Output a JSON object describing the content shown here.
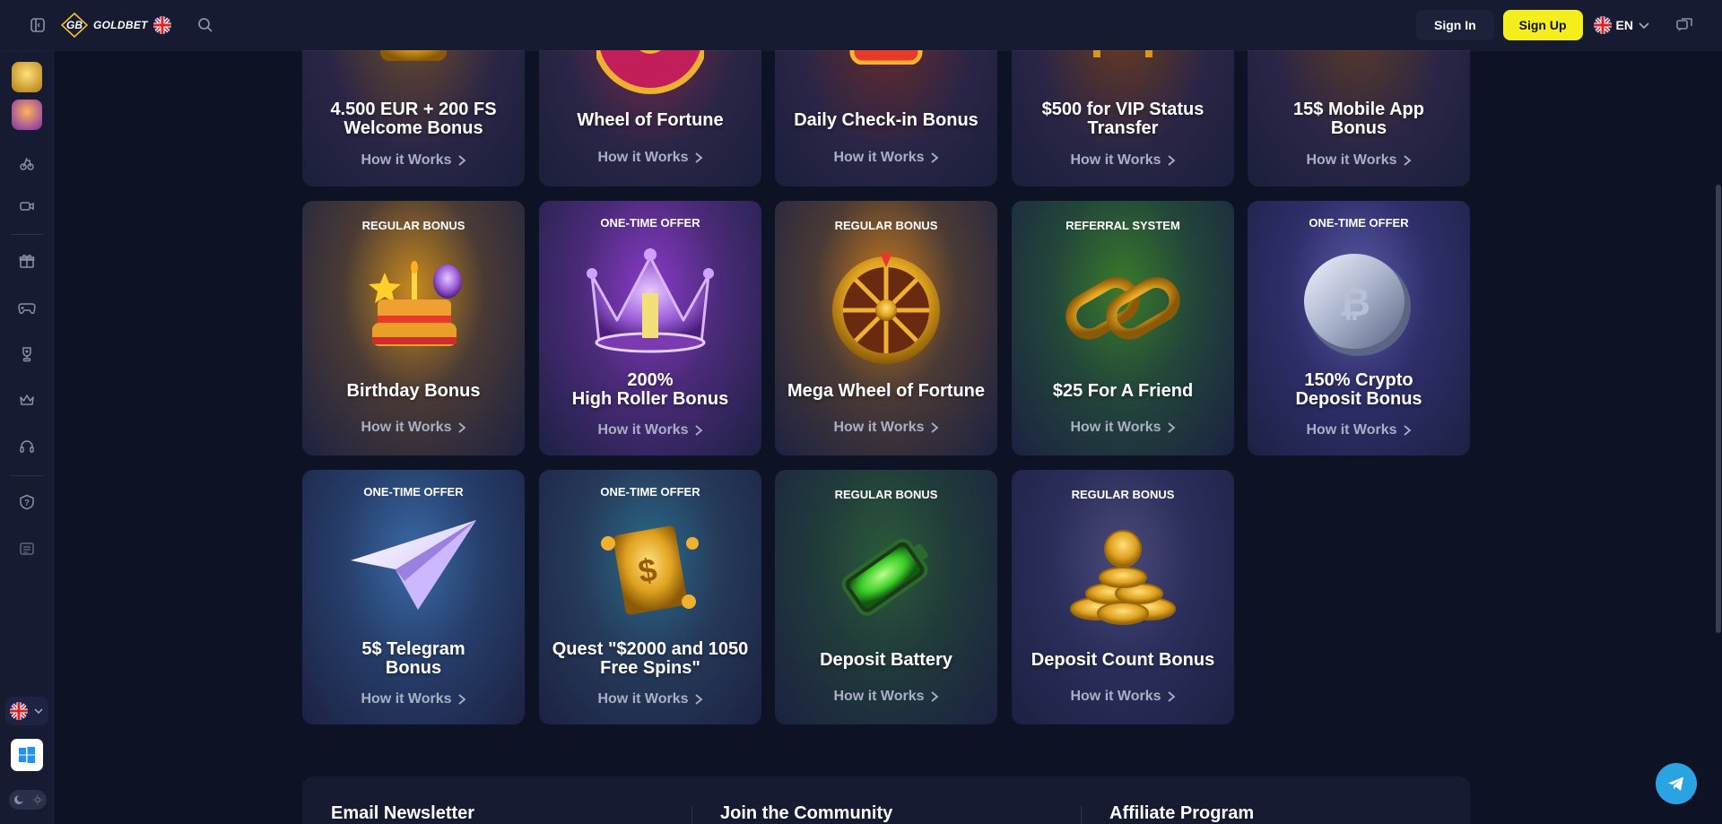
{
  "header": {
    "logo_text": "GOLDBET",
    "sign_in": "Sign In",
    "sign_up": "Sign Up",
    "language": "EN"
  },
  "icons": {
    "sidebar_toggle": "sidebar-toggle-icon",
    "search": "search-icon",
    "chat": "chat-icon"
  },
  "colors": {
    "background": "#0d1224",
    "panel": "#161b31",
    "accent_yellow": "#f4ee1d",
    "telegram": "#2aa3e3"
  },
  "sidebar": {
    "items": [
      "sports-icon",
      "live-casino-icon",
      "gift-icon",
      "gamepad-icon",
      "trophy-icon",
      "crown-icon",
      "headset-icon",
      "help-icon",
      "list-icon"
    ]
  },
  "cards_row1": [
    {
      "title": "4.500 EUR + 200 FS\nWelcome Bonus",
      "how": "How it Works"
    },
    {
      "title": "Wheel of Fortune",
      "how": "How it Works"
    },
    {
      "title": "Daily Check-in Bonus",
      "how": "How it Works"
    },
    {
      "title": "$500 for VIP Status\nTransfer",
      "how": "How it Works"
    },
    {
      "title": "15$ Mobile App\nBonus",
      "how": "How it Works"
    }
  ],
  "cards_row2": [
    {
      "tag": "REGULAR BONUS",
      "title": "Birthday Bonus",
      "how": "How it Works"
    },
    {
      "tag": "ONE-TIME OFFER",
      "title": "200%\nHigh Roller Bonus",
      "how": "How it Works"
    },
    {
      "tag": "REGULAR BONUS",
      "title": "Mega Wheel of Fortune",
      "how": "How it Works"
    },
    {
      "tag": "REFERRAL SYSTEM",
      "title": "$25 For A Friend",
      "how": "How it Works"
    },
    {
      "tag": "ONE-TIME OFFER",
      "title": "150% Crypto\nDeposit Bonus",
      "how": "How it Works"
    }
  ],
  "cards_row3": [
    {
      "tag": "ONE-TIME OFFER",
      "title": "5$ Telegram\nBonus",
      "how": "How it Works"
    },
    {
      "tag": "ONE-TIME OFFER",
      "title": "Quest \"$2000 and 1050\nFree Spins\"",
      "how": "How it Works"
    },
    {
      "tag": "REGULAR BONUS",
      "title": "Deposit Battery",
      "how": "How it Works"
    },
    {
      "tag": "REGULAR BONUS",
      "title": "Deposit Count Bonus",
      "how": "How it Works"
    }
  ],
  "footer": {
    "newsletter": "Email Newsletter",
    "community": "Join the Community",
    "affiliate": "Affiliate Program"
  }
}
